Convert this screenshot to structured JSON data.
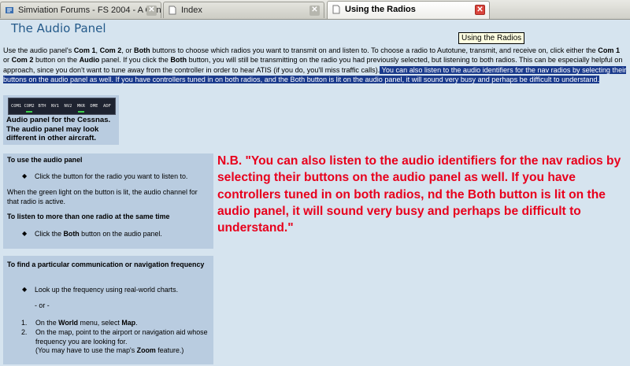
{
  "tabs": [
    {
      "label": "Simviation Forums - FS 2004 - A Centu...",
      "icon": "forum-icon",
      "active": false
    },
    {
      "label": "Index",
      "icon": "page-icon",
      "active": false
    },
    {
      "label": "Using the Radios",
      "icon": "page-icon",
      "active": true
    }
  ],
  "tab_close_glyph": "✕",
  "tooltip": "Using the Radios",
  "page": {
    "title": "The Audio Panel",
    "intro": {
      "s1": "Use the audio panel's ",
      "b1": "Com 1",
      "s2": ", ",
      "b2": "Com 2",
      "s3": ", or ",
      "b3": "Both",
      "s4": " buttons to choose which radios you want to transmit on and listen to. To choose a radio to Autotune, transmit, and receive on, click either the ",
      "b4": "Com 1",
      "s5": " or ",
      "b5": "Com 2",
      "s6": " button on the ",
      "b6": "Audio",
      "s7": " panel. If you click the ",
      "b7": "Both",
      "s8": " button, you will still be transmitting on the radio you had previously selected, but listening to both radios. This can be especially helpful on approach, since you don't want to tune away from the controller in order to hear ATIS (if you do, you'll miss traffic calls).",
      "highlight": " You can also listen to the audio identifiers for the nav radios by selecting their buttons on the audio panel as well. If you have controllers tuned in on both radios, and the Both button is lit on the audio panel, it will sound very busy and perhaps be difficult to understand."
    },
    "figure": {
      "buttons": [
        "COM1",
        "COM2",
        "BTH",
        "NV1",
        "NV2",
        "MKR",
        "DME",
        "ADF"
      ],
      "caption": "Audio panel for the Cessnas. The audio panel may look different in other aircraft."
    },
    "box1": {
      "heading": "To use the audio panel",
      "bullet1": "Click the button for the radio you want to listen to.",
      "text": "When the green light on the button is lit, the audio channel for that radio is active.",
      "heading2": "To listen to more than one radio at the same time",
      "bullet2_pre": "Click the ",
      "bullet2_bold": "Both",
      "bullet2_post": " button on the audio panel."
    },
    "box2": {
      "heading": "To find a particular communication or navigation frequency",
      "bullet1": "Look up the frequency using real-world charts.",
      "or": "- or -",
      "step1_num": "1.",
      "step1_pre": "On the ",
      "step1_b1": "World",
      "step1_mid": " menu, select ",
      "step1_b2": "Map",
      "step1_post": ".",
      "step2_num": "2.",
      "step2_l1": "On the map, point to the airport or navigation aid whose",
      "step2_l2": "frequency you are looking for.",
      "step2_l3_pre": "(You may have to use the map's ",
      "step2_l3_b": "Zoom",
      "step2_l3_post": " feature.)"
    },
    "note": "N.B. \"You can also listen to the audio identifiers for the nav radios by selecting their buttons on the audio panel as well. If you have controllers tuned in on both radios, nd the Both button is lit on the audio panel, it will sound very busy and perhaps be difficult to understand.\""
  },
  "colors": {
    "note": "#e8001c",
    "title": "#245a8a",
    "box": "#b9cce0",
    "highlight": "#1a3a8c",
    "led": "#3cd04a"
  }
}
